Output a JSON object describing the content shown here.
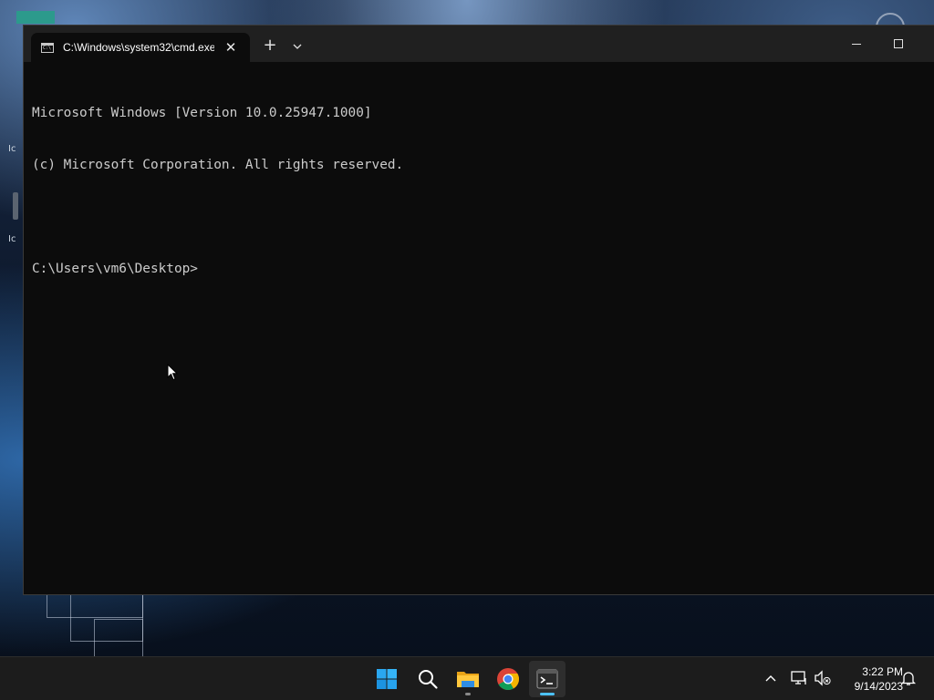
{
  "window": {
    "tab_title": "C:\\Windows\\system32\\cmd.exe",
    "tab_icon_text": "C:\\",
    "tab_close_glyph": "✕",
    "new_tab_glyph": "+"
  },
  "console": {
    "lines": [
      "Microsoft Windows [Version 10.0.25947.1000]",
      "(c) Microsoft Corporation. All rights reserved.",
      "",
      "C:\\Users\\vm6\\Desktop>"
    ]
  },
  "desktop": {
    "icon_label_1": "Ic",
    "icon_label_2": "Ic"
  },
  "taskbar": {
    "apps": [
      {
        "name": "start",
        "icon": "windows-logo-icon",
        "running": false
      },
      {
        "name": "search",
        "icon": "search-icon",
        "running": false
      },
      {
        "name": "file-explorer",
        "icon": "folder-icon",
        "running": true
      },
      {
        "name": "chrome",
        "icon": "chrome-icon",
        "running": false
      },
      {
        "name": "terminal",
        "icon": "terminal-icon",
        "running": true,
        "active": true
      }
    ],
    "tray": {
      "overflow_glyph": "^",
      "time": "3:22 PM",
      "date": "9/14/2023"
    }
  },
  "colors": {
    "console_bg": "#0c0c0c",
    "console_fg": "#cccccc",
    "titlebar_bg": "#202020",
    "taskbar_bg": "#1c1c1c",
    "accent": "#4cc2ff"
  }
}
